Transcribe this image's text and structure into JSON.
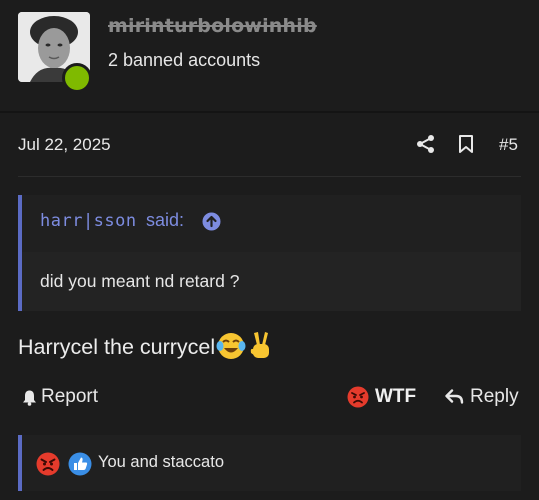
{
  "author": {
    "username": "mirinturbolowinhib",
    "banned_accounts": "2 banned accounts",
    "status_color": "#7fba00"
  },
  "post": {
    "date": "Jul 22, 2025",
    "number": "#5",
    "icons": [
      "share-icon",
      "bookmark-icon"
    ]
  },
  "quote": {
    "author": "harr|sson",
    "said": "said:",
    "body": "did you meant nd retard ?",
    "accent_color": "#5b6bc4"
  },
  "message": {
    "text": "Harrycel the currycel",
    "emojis": [
      "face-with-tears-of-joy",
      "victory-hand"
    ]
  },
  "actions": {
    "report": "Report",
    "reaction": "WTF",
    "reply": "Reply"
  },
  "reactions": {
    "summary": "You and staccato",
    "icons": [
      "angry-face-icon",
      "thumbs-up-icon"
    ]
  }
}
